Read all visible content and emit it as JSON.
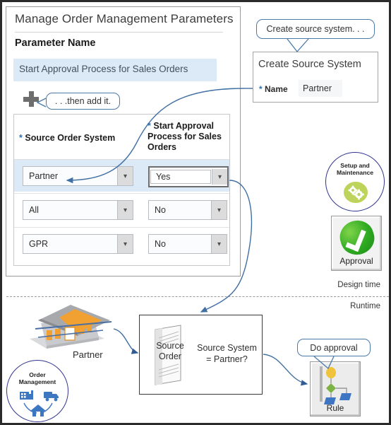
{
  "page": {
    "title": "Manage Order Management Parameters",
    "parameter_name_label": "Parameter Name",
    "parameter_name_value": "Start Approval Process for Sales Orders",
    "add_icon": "plus-icon"
  },
  "callouts": {
    "add": ". . .then add it.",
    "create_source": "Create source system. . .",
    "do_approval": "Do approval"
  },
  "table": {
    "columns": [
      {
        "required_marker": "*",
        "label": "Source Order System"
      },
      {
        "required_marker": "*",
        "label": "Start Approval Process for Sales Orders"
      }
    ],
    "rows": [
      {
        "source_order_system": "Partner",
        "start_approval": "Yes",
        "selected": true,
        "approval_focused": true
      },
      {
        "source_order_system": "All",
        "start_approval": "No",
        "selected": false,
        "approval_focused": false
      },
      {
        "source_order_system": "GPR",
        "start_approval": "No",
        "selected": false,
        "approval_focused": false
      }
    ]
  },
  "create_source_system": {
    "title": "Create Source System",
    "name_required_marker": "*",
    "name_label": "Name",
    "name_value": "Partner"
  },
  "setup_badge": {
    "line1": "Setup and",
    "line2": "Maintenance",
    "icon": "gears-icon"
  },
  "approval_tile": {
    "label": "Approval",
    "icon": "green-check-icon"
  },
  "phases": {
    "design_time": "Design time",
    "runtime": "Runtime"
  },
  "runtime": {
    "partner_label": "Partner",
    "partner_icon": "building-icon",
    "order_management_badge": {
      "line1": "Order",
      "line2": "Management",
      "icon": "supply-chain-icon"
    },
    "decision": {
      "document_line1": "Source",
      "document_line2": "Order",
      "document_icon": "document-icon",
      "condition_line1": "Source System",
      "condition_line2": "= Partner?"
    },
    "rule_tile": {
      "label": "Rule",
      "icon": "rule-tree-icon"
    }
  },
  "colors": {
    "accent_blue": "#4a79a8",
    "highlight_row": "#dceaf7",
    "required_star": "#2f6fb0",
    "badge_ring": "#31348f",
    "approval_green": "#2faa22",
    "gear_green": "#bcd45b"
  }
}
